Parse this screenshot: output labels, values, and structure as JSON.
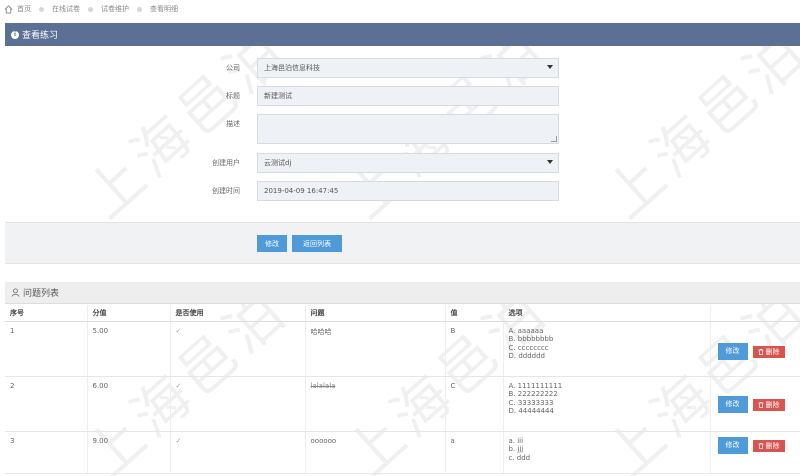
{
  "breadcrumb": [
    "首页",
    "在线试卷",
    "试卷维护",
    "查看明细"
  ],
  "panel": {
    "title": "查看练习"
  },
  "form": {
    "company": {
      "label": "公司",
      "value": "上海邑泊信息科技"
    },
    "title": {
      "label": "标题",
      "value": "新建测试"
    },
    "description": {
      "label": "描述",
      "value": ""
    },
    "creator": {
      "label": "创建用户",
      "value": "云测试dj"
    },
    "created_time": {
      "label": "创建时间",
      "value": "2019-04-09 16:47:45"
    }
  },
  "actions": {
    "edit_label": "修改",
    "back_label": "返回列表"
  },
  "list": {
    "title": "问题列表",
    "columns": [
      "序号",
      "分值",
      "是否使用",
      "问题",
      "值",
      "选项",
      ""
    ],
    "rows": [
      {
        "index": "1",
        "score": "5.00",
        "used": "✓",
        "question": "哈哈哈",
        "value": "B",
        "options": [
          "A. aaaaaa",
          "B. bbbbbbbb",
          "C. cccccccc",
          "D. dddddd"
        ]
      },
      {
        "index": "2",
        "score": "6.00",
        "used": "✓",
        "question": "lalalala",
        "value": "C",
        "options": [
          "A. 1111111111",
          "B. 222222222",
          "C. 33333333",
          "D. 44444444"
        ]
      },
      {
        "index": "3",
        "score": "9.00",
        "used": "✓",
        "question": "oooooo",
        "value": "a",
        "options": [
          "a. iii",
          "b. jjj",
          "c. ddd"
        ]
      }
    ],
    "edit_label": "修改",
    "delete_label": "删除"
  },
  "watermark": "上海邑泊",
  "colors": {
    "header": "#5b7094",
    "primary": "#4f9ad8",
    "danger": "#d9534f"
  }
}
